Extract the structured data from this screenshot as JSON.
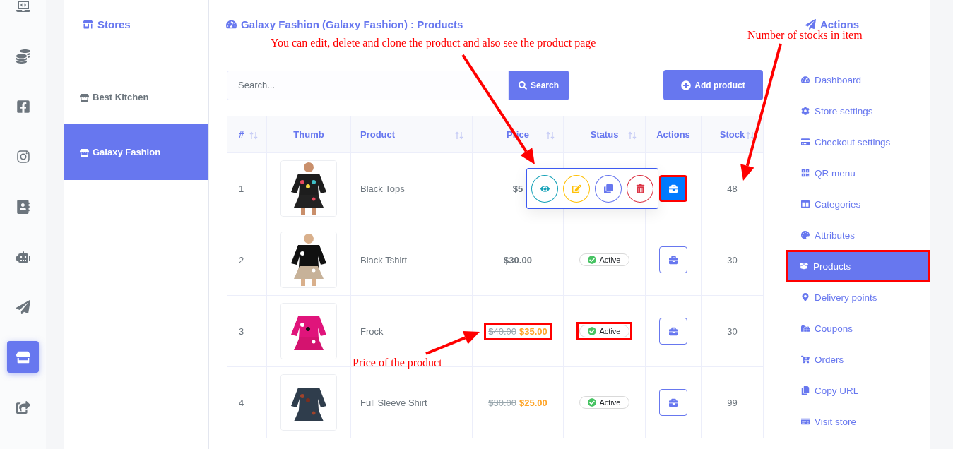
{
  "rail": [
    {
      "selected": false
    },
    {
      "selected": false
    },
    {
      "selected": false
    },
    {
      "selected": false
    },
    {
      "selected": false
    },
    {
      "selected": false
    },
    {
      "selected": false
    },
    {
      "selected": true
    },
    {
      "selected": false
    }
  ],
  "stores": {
    "title": "Stores",
    "items": [
      {
        "label": "Best Kitchen",
        "selected": false
      },
      {
        "label": "Galaxy Fashion",
        "selected": true
      }
    ]
  },
  "main": {
    "title": "Galaxy Fashion (Galaxy Fashion) : Products",
    "search": {
      "placeholder": "Search...",
      "button": "Search"
    },
    "add_button": "Add product"
  },
  "table": {
    "columns": [
      {
        "label": "#",
        "sortable": true
      },
      {
        "label": "Thumb",
        "sortable": false
      },
      {
        "label": "Product",
        "sortable": true
      },
      {
        "label": "Price",
        "sortable": true
      },
      {
        "label": "Status",
        "sortable": true
      },
      {
        "label": "Actions",
        "sortable": false
      },
      {
        "label": "Stock",
        "sortable": true
      }
    ],
    "rows": [
      {
        "index": "1",
        "product": "Black Tops",
        "price": {
          "current": "$5"
        },
        "actions_open": true,
        "actions_highlighted": true,
        "stock": "48"
      },
      {
        "index": "2",
        "product": "Black Tshirt",
        "price": {
          "current": "$30.00"
        },
        "status": "Active",
        "status_highlighted": false,
        "actions_open": false,
        "actions_highlighted": false,
        "stock": "30"
      },
      {
        "index": "3",
        "product": "Frock",
        "price": {
          "old": "$40.00",
          "current": "$35.00",
          "highlighted": true
        },
        "status": "Active",
        "status_highlighted": true,
        "actions_open": false,
        "actions_highlighted": false,
        "stock": "30"
      },
      {
        "index": "4",
        "product": "Full Sleeve Shirt",
        "price": {
          "old": "$30.00",
          "current": "$25.00",
          "highlighted": false
        },
        "status": "Active",
        "status_highlighted": false,
        "actions_open": false,
        "actions_highlighted": false,
        "stock": "99"
      }
    ],
    "row_actions": [
      {
        "kind": "view"
      },
      {
        "kind": "edit"
      },
      {
        "kind": "clone"
      },
      {
        "kind": "delete"
      }
    ]
  },
  "actions_panel": {
    "title": "Actions",
    "items": [
      {
        "label": "Dashboard",
        "selected": false,
        "highlighted": false
      },
      {
        "label": "Store settings",
        "selected": false,
        "highlighted": false
      },
      {
        "label": "Checkout settings",
        "selected": false,
        "highlighted": false
      },
      {
        "label": "QR menu",
        "selected": false,
        "highlighted": false
      },
      {
        "label": "Categories",
        "selected": false,
        "highlighted": false
      },
      {
        "label": "Attributes",
        "selected": false,
        "highlighted": false
      },
      {
        "label": "Products",
        "selected": true,
        "highlighted": true
      },
      {
        "label": "Delivery points",
        "selected": false,
        "highlighted": false
      },
      {
        "label": "Coupons",
        "selected": false,
        "highlighted": false
      },
      {
        "label": "Orders",
        "selected": false,
        "highlighted": false
      },
      {
        "label": "Copy URL",
        "selected": false,
        "highlighted": false
      },
      {
        "label": "Visit store",
        "selected": false,
        "highlighted": false
      }
    ]
  },
  "annotations": [
    {
      "text": "You can edit, delete and clone the product and also see the product page"
    },
    {
      "text": "Number of stocks in item"
    },
    {
      "text": "Price of the product"
    }
  ]
}
